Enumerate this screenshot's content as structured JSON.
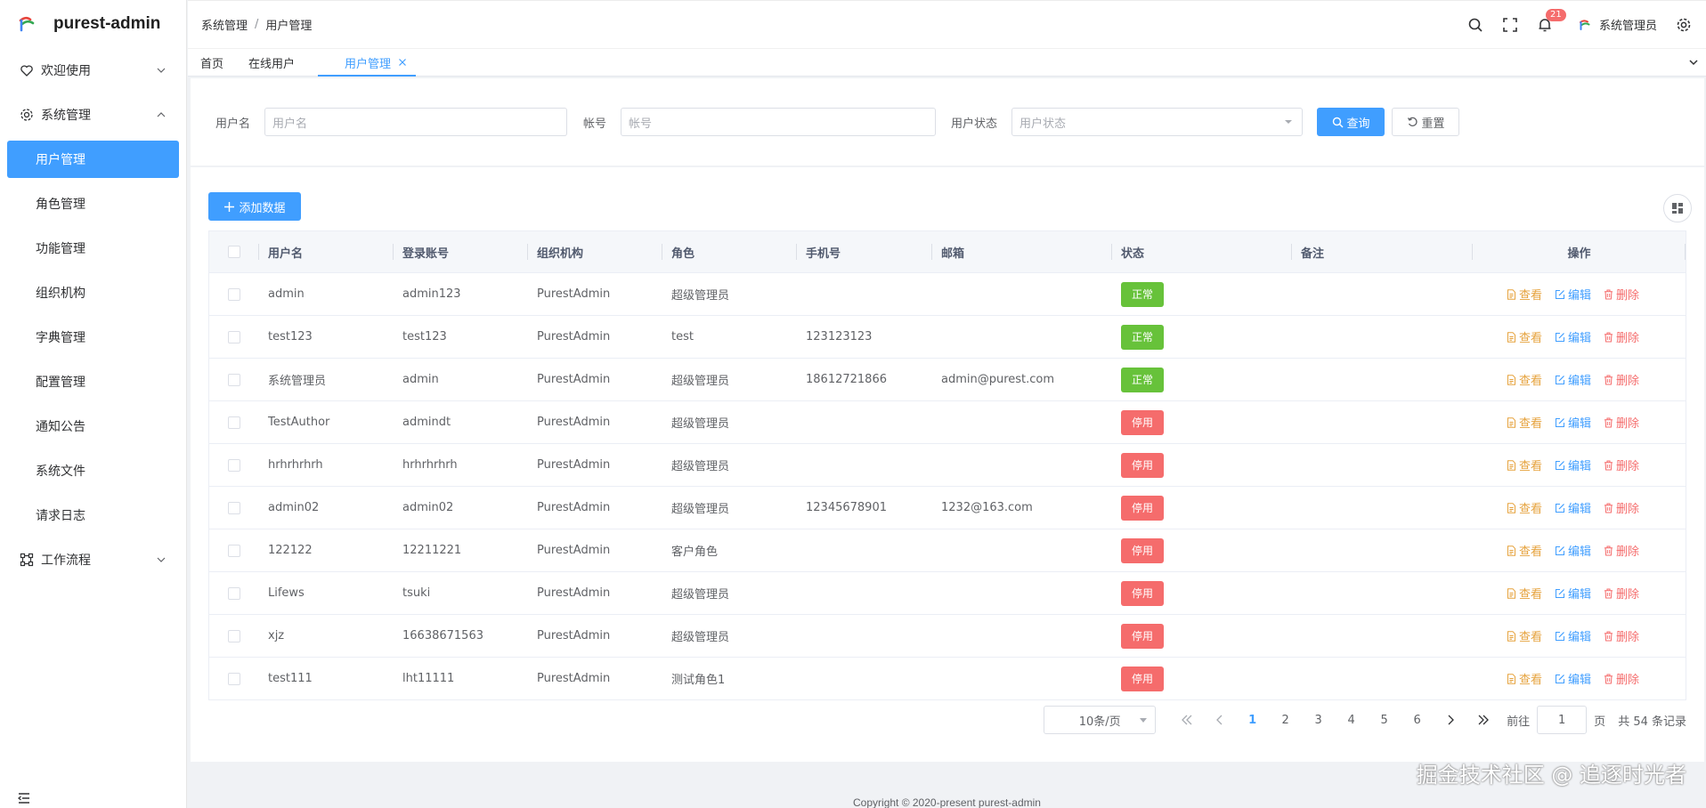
{
  "app": {
    "title": "purest-admin"
  },
  "sidebar": {
    "groups": [
      {
        "label": "欢迎使用"
      },
      {
        "label": "系统管理"
      },
      {
        "label": "工作流程"
      }
    ],
    "items": [
      {
        "label": "用户管理"
      },
      {
        "label": "角色管理"
      },
      {
        "label": "功能管理"
      },
      {
        "label": "组织机构"
      },
      {
        "label": "字典管理"
      },
      {
        "label": "配置管理"
      },
      {
        "label": "通知公告"
      },
      {
        "label": "系统文件"
      },
      {
        "label": "请求日志"
      }
    ]
  },
  "header": {
    "breadcrumb": [
      "系统管理",
      "用户管理"
    ],
    "breadcrumb_sep": "/",
    "notification_count": "21",
    "user_name": "系统管理员"
  },
  "tabs": [
    {
      "label": "首页"
    },
    {
      "label": "在线用户"
    },
    {
      "label": "用户管理"
    }
  ],
  "search": {
    "username_label": "用户名",
    "username_placeholder": "用户名",
    "account_label": "帐号",
    "account_placeholder": "帐号",
    "status_label": "用户状态",
    "status_placeholder": "用户状态",
    "query_label": "查询",
    "reset_label": "重置"
  },
  "table": {
    "add_label": "添加数据",
    "columns": [
      "用户名",
      "登录账号",
      "组织机构",
      "角色",
      "手机号",
      "邮箱",
      "状态",
      "备注",
      "操作"
    ],
    "ops": {
      "view": "查看",
      "edit": "编辑",
      "delete": "删除"
    },
    "rows": [
      {
        "username": "admin",
        "account": "admin123",
        "org": "PurestAdmin",
        "role": "超级管理员",
        "phone": "",
        "email": "",
        "status": "正常",
        "remark": ""
      },
      {
        "username": "test123",
        "account": "test123",
        "org": "PurestAdmin",
        "role": "test",
        "phone": "123123123",
        "email": "",
        "status": "正常",
        "remark": ""
      },
      {
        "username": "系统管理员",
        "account": "admin",
        "org": "PurestAdmin",
        "role": "超级管理员",
        "phone": "18612721866",
        "email": "admin@purest.com",
        "status": "正常",
        "remark": ""
      },
      {
        "username": "TestAuthor",
        "account": "admindt",
        "org": "PurestAdmin",
        "role": "超级管理员",
        "phone": "",
        "email": "",
        "status": "停用",
        "remark": ""
      },
      {
        "username": "hrhrhrhrh",
        "account": "hrhrhrhrh",
        "org": "PurestAdmin",
        "role": "超级管理员",
        "phone": "",
        "email": "",
        "status": "停用",
        "remark": ""
      },
      {
        "username": "admin02",
        "account": "admin02",
        "org": "PurestAdmin",
        "role": "超级管理员",
        "phone": "12345678901",
        "email": "1232@163.com",
        "status": "停用",
        "remark": ""
      },
      {
        "username": "122122",
        "account": "12211221",
        "org": "PurestAdmin",
        "role": "客户角色",
        "phone": "",
        "email": "",
        "status": "停用",
        "remark": ""
      },
      {
        "username": "Lifews",
        "account": "tsuki",
        "org": "PurestAdmin",
        "role": "超级管理员",
        "phone": "",
        "email": "",
        "status": "停用",
        "remark": ""
      },
      {
        "username": "xjz",
        "account": "16638671563",
        "org": "PurestAdmin",
        "role": "超级管理员",
        "phone": "",
        "email": "",
        "status": "停用",
        "remark": ""
      },
      {
        "username": "test111",
        "account": "lht11111",
        "org": "PurestAdmin",
        "role": "测试角色1",
        "phone": "",
        "email": "",
        "status": "停用",
        "remark": ""
      }
    ]
  },
  "pagination": {
    "page_size": "10条/页",
    "pages": [
      "1",
      "2",
      "3",
      "4",
      "5",
      "6"
    ],
    "current_page": "1",
    "goto_prefix": "前往",
    "goto_value": "1",
    "goto_suffix": "页",
    "total_text": "共 54 条记录"
  },
  "footer": {
    "copyright": "Copyright © 2020-present purest-admin",
    "watermark": "掘金技术社区 @ 追逐时光者"
  },
  "colors": {
    "primary": "#409eff",
    "success": "#67c23a",
    "danger": "#f56c6c",
    "warning": "#e6a23c"
  }
}
